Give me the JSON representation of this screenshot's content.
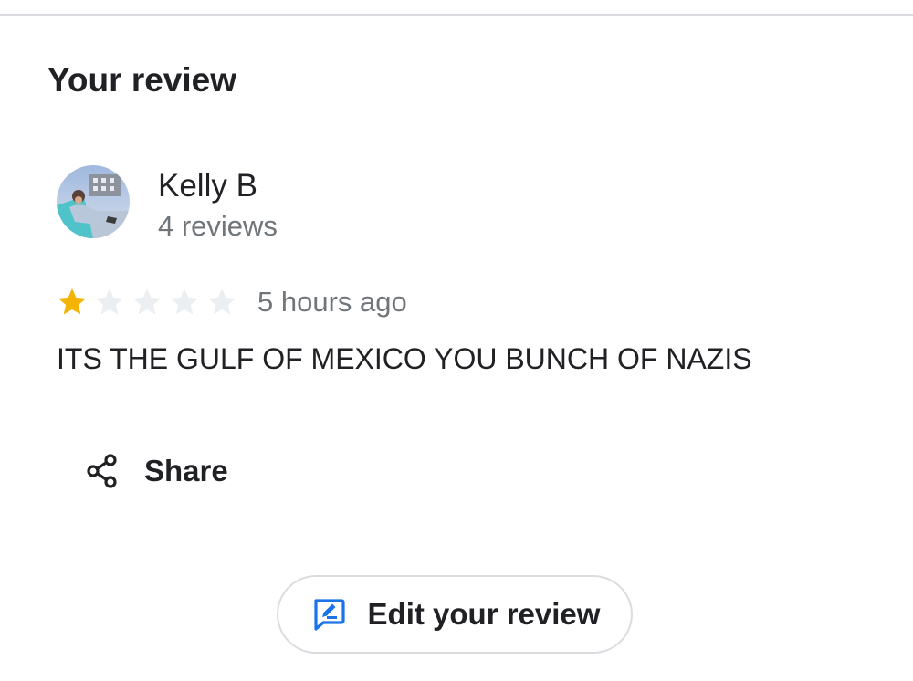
{
  "section": {
    "title": "Your review"
  },
  "author": {
    "name": "Kelly B",
    "meta": "4 reviews",
    "avatar_icon": "user-photo-avatar"
  },
  "review": {
    "rating": 1,
    "max_rating": 5,
    "time": "5 hours ago",
    "text": "ITS THE GULF OF MEXICO YOU BUNCH OF NAZIS"
  },
  "actions": {
    "share_label": "Share",
    "share_icon": "share-icon",
    "edit_label": "Edit your review",
    "edit_icon": "edit-review-icon"
  },
  "colors": {
    "star_filled": "#f4b400",
    "star_empty": "#eceff1",
    "accent": "#1a73e8",
    "text_primary": "#202124",
    "text_secondary": "#70757a"
  }
}
